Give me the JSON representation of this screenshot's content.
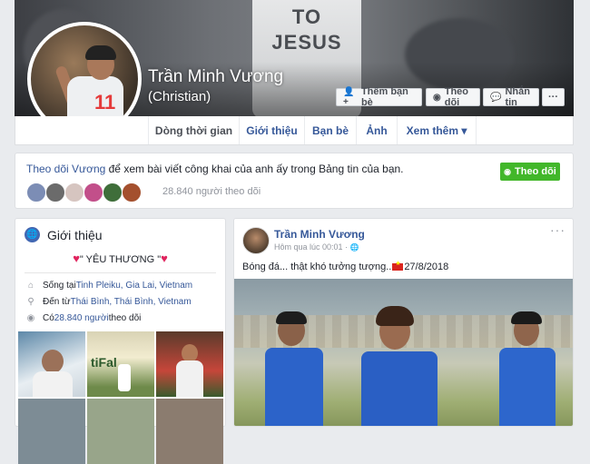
{
  "profile": {
    "name": "Trần Minh Vương",
    "alternate_name": "(Christian)",
    "cover_text": [
      "TO",
      "JESUS"
    ],
    "avatar_number": "11"
  },
  "cover_buttons": [
    {
      "icon": "add-friend-icon",
      "label": "Thêm bạn bè"
    },
    {
      "icon": "rss-icon",
      "label": "Theo dõi"
    },
    {
      "icon": "messenger-icon",
      "label": "Nhắn tin"
    },
    {
      "icon": "more-icon",
      "label": "···"
    }
  ],
  "tabs": [
    {
      "label": "Dòng thời gian",
      "active": true
    },
    {
      "label": "Giới thiệu"
    },
    {
      "label": "Bạn bè"
    },
    {
      "label": "Ảnh"
    },
    {
      "label": "Xem thêm ▾"
    }
  ],
  "follow_bar": {
    "link": "Theo dõi Vương",
    "text": " để xem bài viết công khai của anh ấy trong Bảng tin của bạn.",
    "button": "Theo dõi",
    "count": "28.840 người theo dõi"
  },
  "intro": {
    "title": "Giới thiệu",
    "bio_text": "\" YÊU THƯƠNG \"",
    "lives_prefix": "Sống tại ",
    "lives_place": "Tinh Pleiku, Gia Lai, Vietnam",
    "from_prefix": "Đến từ ",
    "from_place": "Thái Bình, Thái Bình, Vietnam",
    "followers_prefix": "Có ",
    "followers_link": "28.840 người",
    "followers_suffix": " theo dõi"
  },
  "post": {
    "author": "Trần Minh Vương",
    "time": "Hôm qua lúc 00:01 ·",
    "text_before": "Bóng đá... thật khó tưởng tượng..",
    "text_after": "27/8/2018",
    "more": "···"
  },
  "colors": {
    "link": "#365899",
    "follow_green": "#42b72a",
    "page_bg": "#e9ebee"
  }
}
